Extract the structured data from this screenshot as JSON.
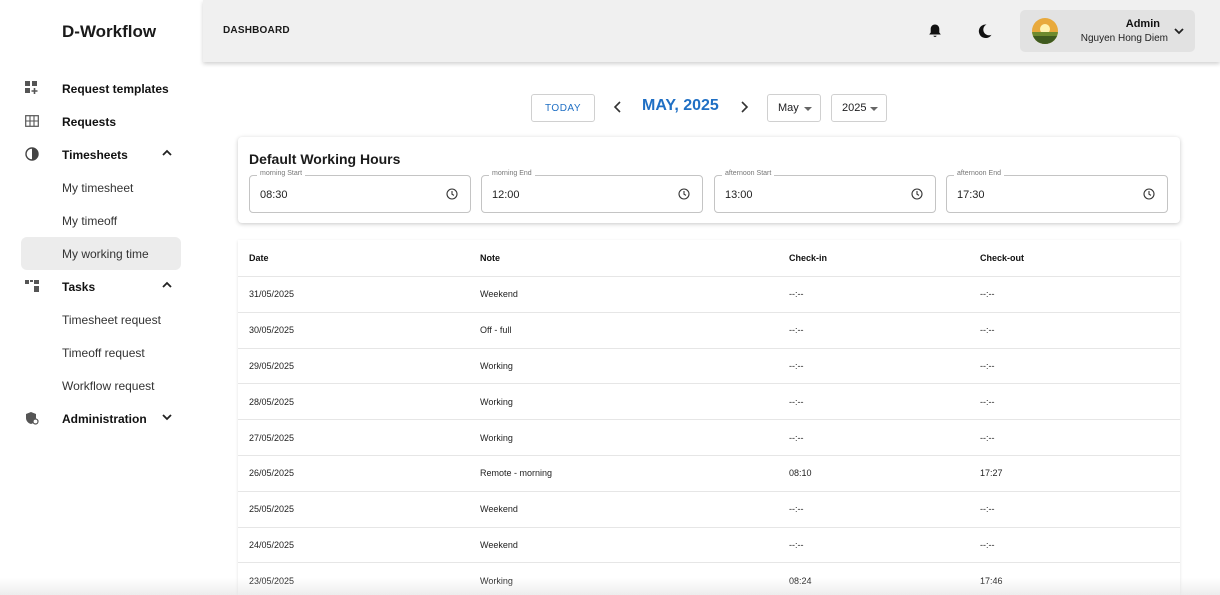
{
  "app": {
    "brand": "D-Workflow"
  },
  "sidebar": {
    "items": [
      {
        "label": "Request templates"
      },
      {
        "label": "Requests"
      },
      {
        "label": "Timesheets",
        "expanded": true,
        "children": [
          {
            "label": "My timesheet"
          },
          {
            "label": "My timeoff"
          },
          {
            "label": "My working time",
            "active": true
          }
        ]
      },
      {
        "label": "Tasks",
        "expanded": true,
        "children": [
          {
            "label": "Timesheet request"
          },
          {
            "label": "Timeoff request"
          },
          {
            "label": "Workflow request"
          }
        ]
      },
      {
        "label": "Administration",
        "expanded": false
      }
    ]
  },
  "header": {
    "title": "DASHBOARD",
    "user": {
      "role": "Admin",
      "name": "Nguyen Hong Diem"
    }
  },
  "calendar": {
    "today_label": "TODAY",
    "month_title": "MAY, 2025",
    "month_select": "May",
    "year_select": "2025"
  },
  "working_hours": {
    "title": "Default Working Hours",
    "fields": [
      {
        "label": "morning Start",
        "value": "08:30"
      },
      {
        "label": "morning End",
        "value": "12:00"
      },
      {
        "label": "afternoon Start",
        "value": "13:00"
      },
      {
        "label": "afternoon End",
        "value": "17:30"
      }
    ]
  },
  "table": {
    "columns": [
      "Date",
      "Note",
      "Check-in",
      "Check-out"
    ],
    "rows": [
      [
        "31/05/2025",
        "Weekend",
        "--:--",
        "--:--"
      ],
      [
        "30/05/2025",
        "Off - full",
        "--:--",
        "--:--"
      ],
      [
        "29/05/2025",
        "Working",
        "--:--",
        "--:--"
      ],
      [
        "28/05/2025",
        "Working",
        "--:--",
        "--:--"
      ],
      [
        "27/05/2025",
        "Working",
        "--:--",
        "--:--"
      ],
      [
        "26/05/2025",
        "Remote - morning",
        "08:10",
        "17:27"
      ],
      [
        "25/05/2025",
        "Weekend",
        "--:--",
        "--:--"
      ],
      [
        "24/05/2025",
        "Weekend",
        "--:--",
        "--:--"
      ],
      [
        "23/05/2025",
        "Working",
        "08:24",
        "17:46"
      ]
    ]
  },
  "colors": {
    "accent": "#1f6fc4",
    "header_bg": "#f0f0f0",
    "active_bg": "#ececec"
  }
}
